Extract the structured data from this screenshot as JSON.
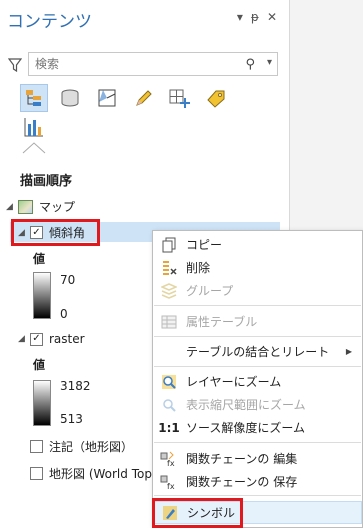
{
  "pane": {
    "title": "コンテンツ",
    "controls": {
      "dropdown": "▾",
      "pin": "ᵽ",
      "close": "✕"
    },
    "search_placeholder": "検索",
    "section_label": "描画順序"
  },
  "tree": {
    "map_label": "マップ",
    "slope_layer": {
      "label": "傾斜角",
      "legend_title": "値",
      "max": "70",
      "min": "0"
    },
    "raster_layer": {
      "label": "raster",
      "legend_title": "値",
      "max": "3182",
      "min": "513"
    },
    "annotation_label": "注記（地形図）",
    "basemap_label": "地形図 (World Topo"
  },
  "menu": {
    "items": [
      {
        "label": "コピー",
        "icon": "copy-icon"
      },
      {
        "label": "削除",
        "icon": "delete-icon"
      },
      {
        "label": "グループ",
        "icon": "group-icon",
        "disabled": true
      },
      {
        "label": "属性テーブル",
        "icon": "attribute-table-icon",
        "disabled": true
      },
      {
        "label": "テーブルの結合とリレート",
        "submenu": "▶"
      },
      {
        "label": "レイヤーにズーム",
        "icon": "zoom-to-layer-icon"
      },
      {
        "label": "表示縮尺範囲にズーム",
        "icon": "zoom-to-visible-scale-icon",
        "disabled": true
      },
      {
        "label": "ソース解像度にズーム",
        "icon": "zoom-to-source-resolution-icon",
        "glyph": "1:1"
      },
      {
        "label": "関数チェーンの 編集",
        "icon": "edit-function-chain-icon"
      },
      {
        "label": "関数チェーンの 保存",
        "icon": "save-function-chain-icon"
      },
      {
        "label": "シンボル",
        "icon": "symbology-icon"
      }
    ]
  },
  "colors": {
    "accent": "#2f6fb3",
    "selection": "#cfe3f7",
    "highlight_box": "#e0191f"
  }
}
